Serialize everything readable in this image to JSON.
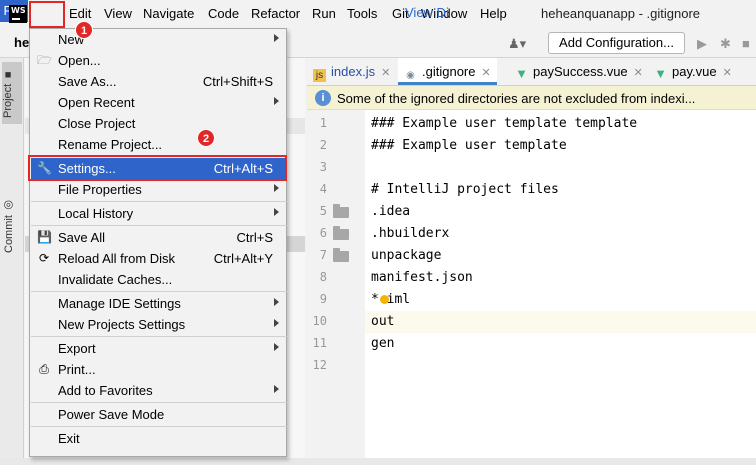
{
  "menubar": {
    "logo_text": "WS",
    "items": [
      "File",
      "Edit",
      "View",
      "Navigate",
      "Code",
      "Refactor",
      "Run",
      "Tools",
      "Git",
      "Window",
      "Help"
    ],
    "project_title": "heheanquanapp - .gitignore"
  },
  "toolbar": {
    "project_crumb": "he",
    "add_configuration": "Add Configuration..."
  },
  "side_tabs": {
    "project": "Project",
    "commit": "Commit"
  },
  "annotations": {
    "step1": "1",
    "step2": "2"
  },
  "file_menu": {
    "new": "New",
    "open": "Open...",
    "save_as": "Save As...",
    "save_as_shortcut": "Ctrl+Shift+S",
    "open_recent": "Open Recent",
    "close_project": "Close Project",
    "rename_project": "Rename Project...",
    "settings": "Settings...",
    "settings_shortcut": "Ctrl+Alt+S",
    "file_properties": "File Properties",
    "local_history": "Local History",
    "save_all": "Save All",
    "save_all_shortcut": "Ctrl+S",
    "reload_all": "Reload All from Disk",
    "reload_all_shortcut": "Ctrl+Alt+Y",
    "invalidate_caches": "Invalidate Caches...",
    "manage_ide_settings": "Manage IDE Settings",
    "new_projects_settings": "New Projects Settings",
    "export": "Export",
    "print": "Print...",
    "add_to_favorites": "Add to Favorites",
    "power_save_mode": "Power Save Mode",
    "exit": "Exit"
  },
  "tabs": [
    {
      "label": "index.js",
      "icon": "js-file-icon"
    },
    {
      "label": ".gitignore",
      "icon": "gitignore-file-icon",
      "active": true
    },
    {
      "label": "paySuccess.vue",
      "icon": "vue-file-icon"
    },
    {
      "label": "pay.vue",
      "icon": "vue-file-icon"
    }
  ],
  "notice": {
    "text": "Some of the ignored directories are not excluded from indexi...",
    "link": "View Di"
  },
  "editor": {
    "line_numbers": [
      "1",
      "2",
      "3",
      "4",
      "5",
      "6",
      "7",
      "8",
      "9",
      "10",
      "11",
      "12"
    ],
    "lines": [
      "### Example user template template",
      "### Example user template",
      "",
      "# IntelliJ project files",
      ".idea",
      ".hbuilderx",
      "unpackage",
      "manifest.json",
      "*.iml",
      "out",
      "gen",
      ""
    ]
  },
  "colors": {
    "accent": "#2f65ca",
    "highlight": "#e22727"
  }
}
